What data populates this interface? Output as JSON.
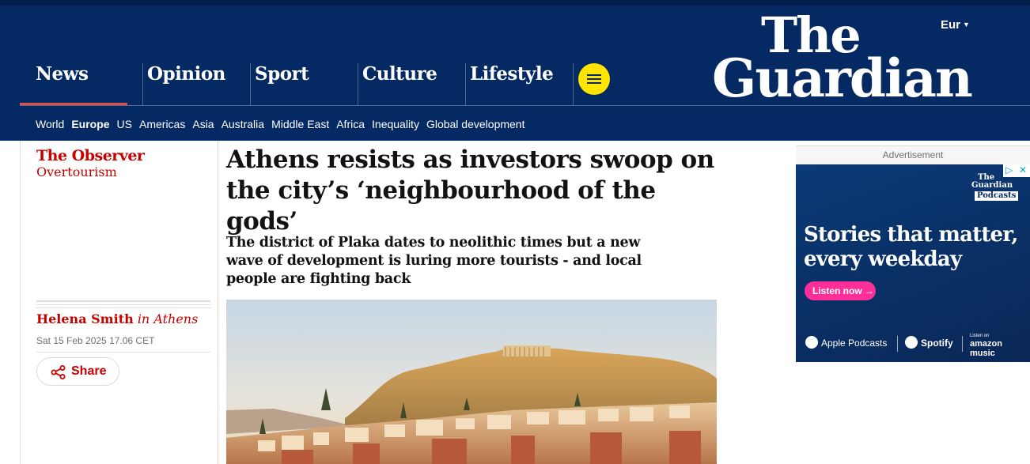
{
  "header": {
    "edition": "Eur",
    "logo_line1": "The",
    "logo_line2": "Guardian",
    "pillars": [
      {
        "label": "News"
      },
      {
        "label": "Opinion"
      },
      {
        "label": "Sport"
      },
      {
        "label": "Culture"
      },
      {
        "label": "Lifestyle"
      }
    ],
    "subnav": [
      "World",
      "Europe",
      "US",
      "Americas",
      "Asia",
      "Australia",
      "Middle East",
      "Africa",
      "Inequality",
      "Global development"
    ],
    "active_subnav": "Europe",
    "colors": {
      "brand": "#052962",
      "accent": "#c70000",
      "menu_button": "#ffe500"
    }
  },
  "article": {
    "series": "The Observer",
    "section": "Overtourism",
    "headline": "Athens resists as investors swoop on the city’s ‘neighbourhood of the gods’",
    "standfirst": "The district of Plaka dates to neolithic times but a new wave of development is luring more tourists - and local people are fighting back",
    "byline_name": "Helena Smith",
    "byline_location": "in Athens",
    "dateline": "Sat 15 Feb 2025 17.06 CET",
    "share_label": "Share"
  },
  "advert": {
    "label": "Advertisement",
    "brand_line1": "The",
    "brand_line2": "Guardian",
    "brand_tag": "Podcasts",
    "headline_line1": "Stories that matter,",
    "headline_line2": "every weekday",
    "cta": "Listen now →",
    "platforms": [
      "Apple Podcasts",
      "Spotify",
      "amazon music"
    ],
    "amazon_prefix": "Listen on"
  }
}
